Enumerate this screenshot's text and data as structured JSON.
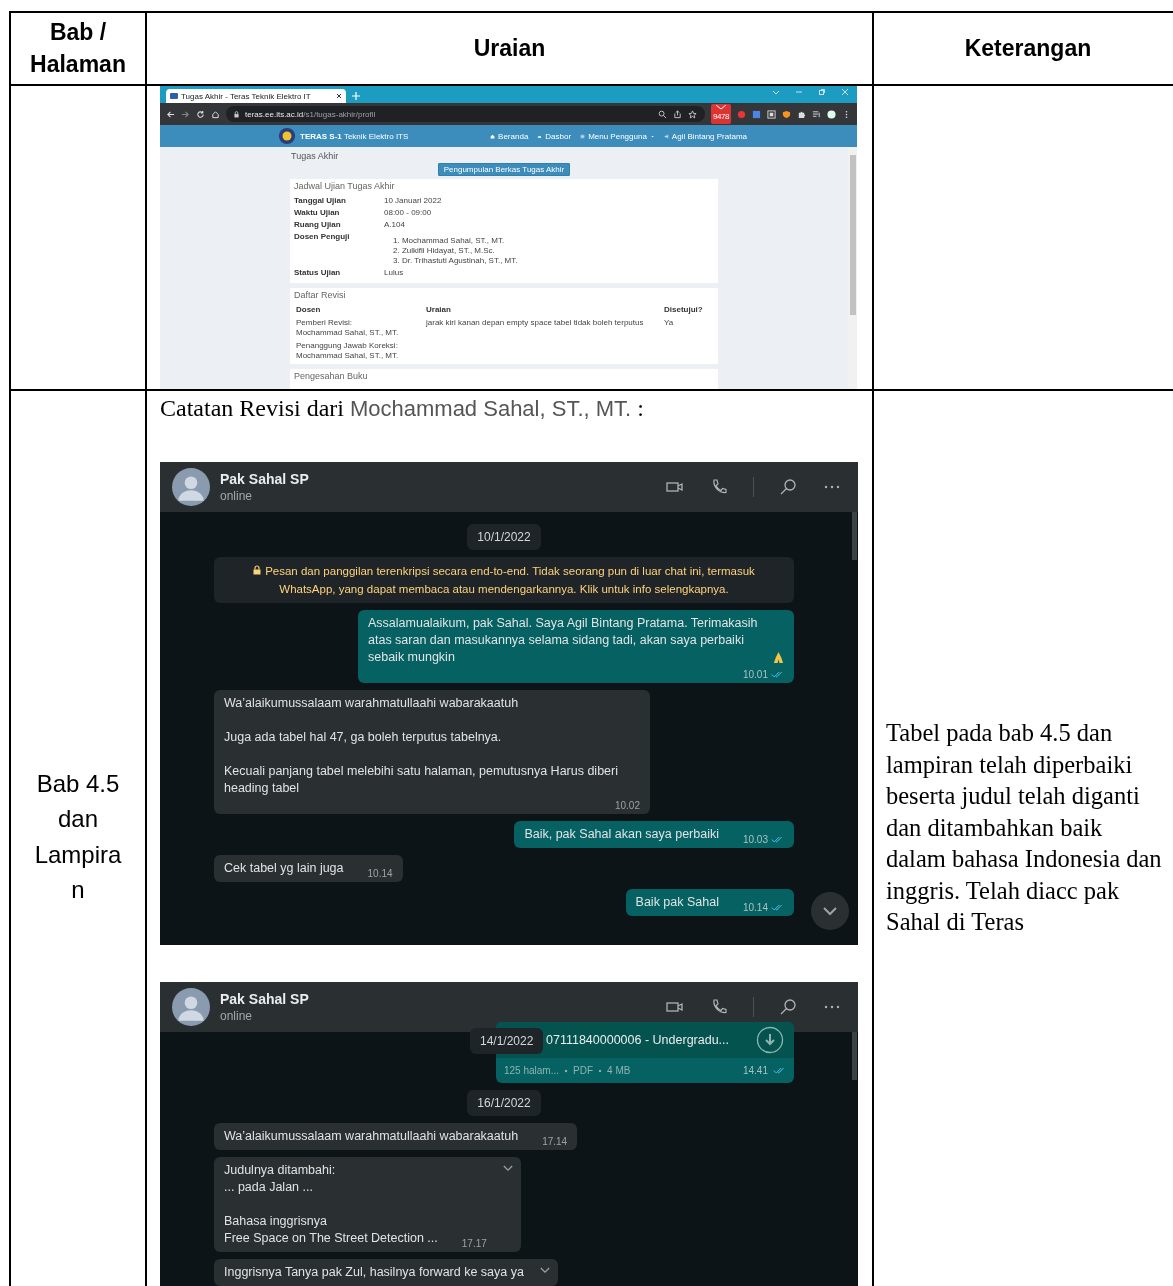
{
  "table": {
    "columns": [
      "Bab / Halaman",
      "Uraian",
      "Keterangan"
    ],
    "row_1": {
      "browser": {
        "tab_title": "Tugas Akhir - Teras Teknik Elektro IT",
        "url_host": "teras.ee.its.ac.id",
        "url_path": "/s1/tugas-akhir/profil",
        "extension_badge": "9478",
        "site_title": "**TERAS S-1** Teknik Elektro ITS",
        "nav": [
          {
            "label": "Beranda",
            "dropdown": false
          },
          {
            "label": "Dasbor",
            "dropdown": false
          },
          {
            "label": "Menu Pengguna",
            "dropdown": true
          },
          {
            "label": "Agil Bintang Pratama",
            "dropdown": false
          }
        ],
        "heading": "Tugas Akhir",
        "button": "Pengumpulan Berkas Tugas Akhir",
        "schedule": {
          "title": "Jadwal Ujian Tugas Akhir",
          "fields": [
            {
              "label": "Tanggal Ujian",
              "values": [
                "10 Januari 2022"
              ]
            },
            {
              "label": "Waktu Ujian",
              "values": [
                "08:00 - 09:00"
              ]
            },
            {
              "label": "Ruang Ujian",
              "values": [
                "A.104"
              ]
            },
            {
              "label": "Dosen Penguji",
              "values": [
                "1. Mochammad Sahal, ST., MT.",
                "2. Zulkifli Hidayat, ST., M.Sc.",
                "3. Dr. Trihastuti Agustinah, ST., MT."
              ]
            },
            {
              "label": "Status Ujian",
              "values": [
                "Lulus"
              ]
            }
          ]
        },
        "revisions": {
          "title": "Daftar Revisi",
          "columns": [
            "Dosen",
            "Uraian",
            "Disetujui?"
          ],
          "rows": [
            {
              "dosen": [
                "Pemberi Revisi:\nMochammad Sahal, ST., MT.",
                "Penanggung Jawab Koreksi:\nMochammad Sahal, ST., MT."
              ],
              "uraian": "jarak kiri kanan depan empty space tabel tidak boleh terputus",
              "disetujui": "Ya"
            }
          ]
        },
        "next_card_title": "Pengesahan Buku"
      }
    },
    "row_2": {
      "bab": "Bab 4.5 dan Lampiran",
      "caption": {
        "text": "Catatan Revisi dari ",
        "name": "Mochammad Sahal, ST., MT.",
        "suffix": " :"
      },
      "chats": [
        {
          "contact": "Pak Sahal SP",
          "status": "online",
          "scroll_down_button": true,
          "messages": [
            {
              "kind": "date",
              "text": "10/1/2022"
            },
            {
              "kind": "system",
              "text": "Pesan dan panggilan terenkripsi secara end-to-end. Tidak seorang pun di luar chat ini, termasuk WhatsApp, yang dapat membaca atau mendengarkannya. Klik untuk info selengkapnya."
            },
            {
              "kind": "out",
              "text": "Assalamualaikum, pak Sahal. Saya Agil Bintang Pratama. Terimakasih atas saran dan masukannya selama sidang tadi, akan saya perbaiki sebaik mungkin",
              "emoji": true,
              "time": "10.01",
              "read": true
            },
            {
              "kind": "in",
              "text": "Wa’alaikumussalaam warahmatullaahi wabarakaatuh\n\nJuga ada tabel hal 47, ga boleh terputus tabelnya.\n\nKecuali panjang tabel melebihi satu halaman, pemutusnya Harus diberi heading tabel",
              "time": "10.02"
            },
            {
              "kind": "out",
              "text": "Baik, pak Sahal akan saya perbaiki",
              "time": "10.03",
              "read": true
            },
            {
              "kind": "in",
              "text": "Cek tabel yg lain juga",
              "time": "10.14"
            },
            {
              "kind": "out",
              "text": "Baik pak Sahal",
              "time": "10.14",
              "read": true
            }
          ]
        },
        {
          "contact": "Pak Sahal SP",
          "status": "online",
          "scroll_down_button": false,
          "messages": [
            {
              "kind": "file",
              "file_name": "07111840000006 - Undergradu...",
              "pages": "125 halam...",
              "type": "PDF",
              "size": "4 MB",
              "time": "14.41",
              "read": true,
              "overlay_date": "14/1/2022"
            },
            {
              "kind": "date",
              "text": "16/1/2022"
            },
            {
              "kind": "in",
              "text": "Wa’alaikumussalaam warahmatullaahi wabarakaatuh",
              "time": "17.14"
            },
            {
              "kind": "in",
              "text": "Judulnya ditambahi:\n... pada Jalan ...\n\nBahasa inggrisnya\nFree Space on The Street Detection ...",
              "time": "17.17",
              "menu": true
            },
            {
              "kind": "in",
              "text": "Inggrisnya Tanya pak Zul, hasilnya forward ke saya ya",
              "menu": true
            }
          ]
        }
      ],
      "keterangan": "Tabel pada bab 4.5 dan lampiran telah diperbaiki beserta judul telah diganti dan ditambahkan baik dalam bahasa Indonesia dan inggris. Telah diacc pak Sahal di Teras"
    }
  }
}
